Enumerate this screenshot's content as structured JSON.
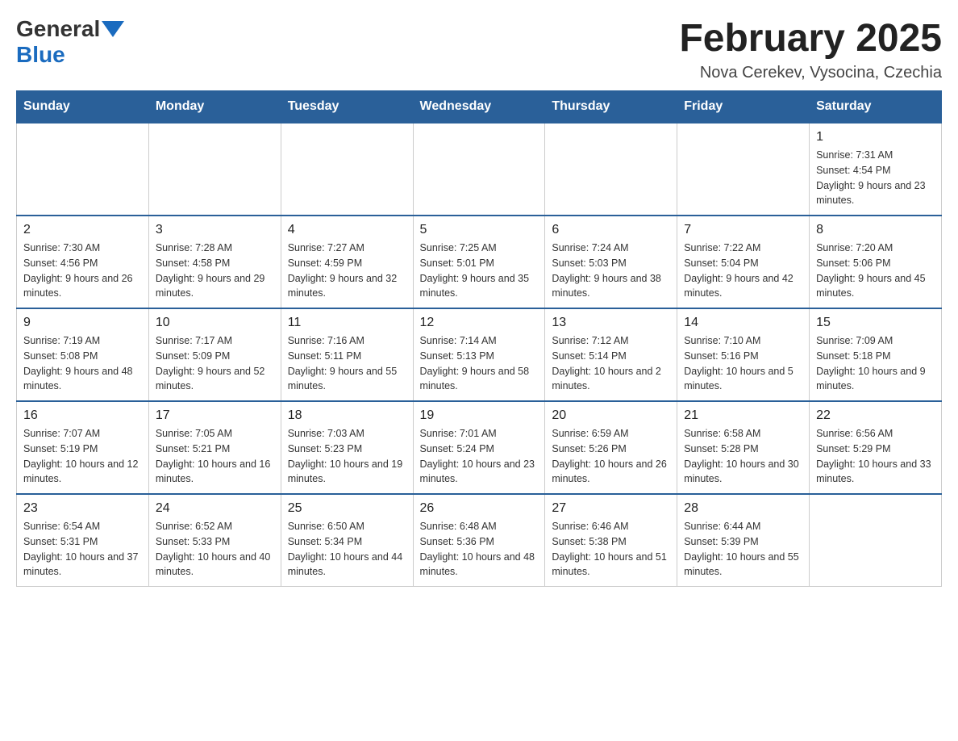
{
  "header": {
    "logo_general": "General",
    "logo_blue": "Blue",
    "month_title": "February 2025",
    "location": "Nova Cerekev, Vysocina, Czechia"
  },
  "weekdays": [
    "Sunday",
    "Monday",
    "Tuesday",
    "Wednesday",
    "Thursday",
    "Friday",
    "Saturday"
  ],
  "weeks": [
    [
      {
        "day": "",
        "sunrise": "",
        "sunset": "",
        "daylight": ""
      },
      {
        "day": "",
        "sunrise": "",
        "sunset": "",
        "daylight": ""
      },
      {
        "day": "",
        "sunrise": "",
        "sunset": "",
        "daylight": ""
      },
      {
        "day": "",
        "sunrise": "",
        "sunset": "",
        "daylight": ""
      },
      {
        "day": "",
        "sunrise": "",
        "sunset": "",
        "daylight": ""
      },
      {
        "day": "",
        "sunrise": "",
        "sunset": "",
        "daylight": ""
      },
      {
        "day": "1",
        "sunrise": "Sunrise: 7:31 AM",
        "sunset": "Sunset: 4:54 PM",
        "daylight": "Daylight: 9 hours and 23 minutes."
      }
    ],
    [
      {
        "day": "2",
        "sunrise": "Sunrise: 7:30 AM",
        "sunset": "Sunset: 4:56 PM",
        "daylight": "Daylight: 9 hours and 26 minutes."
      },
      {
        "day": "3",
        "sunrise": "Sunrise: 7:28 AM",
        "sunset": "Sunset: 4:58 PM",
        "daylight": "Daylight: 9 hours and 29 minutes."
      },
      {
        "day": "4",
        "sunrise": "Sunrise: 7:27 AM",
        "sunset": "Sunset: 4:59 PM",
        "daylight": "Daylight: 9 hours and 32 minutes."
      },
      {
        "day": "5",
        "sunrise": "Sunrise: 7:25 AM",
        "sunset": "Sunset: 5:01 PM",
        "daylight": "Daylight: 9 hours and 35 minutes."
      },
      {
        "day": "6",
        "sunrise": "Sunrise: 7:24 AM",
        "sunset": "Sunset: 5:03 PM",
        "daylight": "Daylight: 9 hours and 38 minutes."
      },
      {
        "day": "7",
        "sunrise": "Sunrise: 7:22 AM",
        "sunset": "Sunset: 5:04 PM",
        "daylight": "Daylight: 9 hours and 42 minutes."
      },
      {
        "day": "8",
        "sunrise": "Sunrise: 7:20 AM",
        "sunset": "Sunset: 5:06 PM",
        "daylight": "Daylight: 9 hours and 45 minutes."
      }
    ],
    [
      {
        "day": "9",
        "sunrise": "Sunrise: 7:19 AM",
        "sunset": "Sunset: 5:08 PM",
        "daylight": "Daylight: 9 hours and 48 minutes."
      },
      {
        "day": "10",
        "sunrise": "Sunrise: 7:17 AM",
        "sunset": "Sunset: 5:09 PM",
        "daylight": "Daylight: 9 hours and 52 minutes."
      },
      {
        "day": "11",
        "sunrise": "Sunrise: 7:16 AM",
        "sunset": "Sunset: 5:11 PM",
        "daylight": "Daylight: 9 hours and 55 minutes."
      },
      {
        "day": "12",
        "sunrise": "Sunrise: 7:14 AM",
        "sunset": "Sunset: 5:13 PM",
        "daylight": "Daylight: 9 hours and 58 minutes."
      },
      {
        "day": "13",
        "sunrise": "Sunrise: 7:12 AM",
        "sunset": "Sunset: 5:14 PM",
        "daylight": "Daylight: 10 hours and 2 minutes."
      },
      {
        "day": "14",
        "sunrise": "Sunrise: 7:10 AM",
        "sunset": "Sunset: 5:16 PM",
        "daylight": "Daylight: 10 hours and 5 minutes."
      },
      {
        "day": "15",
        "sunrise": "Sunrise: 7:09 AM",
        "sunset": "Sunset: 5:18 PM",
        "daylight": "Daylight: 10 hours and 9 minutes."
      }
    ],
    [
      {
        "day": "16",
        "sunrise": "Sunrise: 7:07 AM",
        "sunset": "Sunset: 5:19 PM",
        "daylight": "Daylight: 10 hours and 12 minutes."
      },
      {
        "day": "17",
        "sunrise": "Sunrise: 7:05 AM",
        "sunset": "Sunset: 5:21 PM",
        "daylight": "Daylight: 10 hours and 16 minutes."
      },
      {
        "day": "18",
        "sunrise": "Sunrise: 7:03 AM",
        "sunset": "Sunset: 5:23 PM",
        "daylight": "Daylight: 10 hours and 19 minutes."
      },
      {
        "day": "19",
        "sunrise": "Sunrise: 7:01 AM",
        "sunset": "Sunset: 5:24 PM",
        "daylight": "Daylight: 10 hours and 23 minutes."
      },
      {
        "day": "20",
        "sunrise": "Sunrise: 6:59 AM",
        "sunset": "Sunset: 5:26 PM",
        "daylight": "Daylight: 10 hours and 26 minutes."
      },
      {
        "day": "21",
        "sunrise": "Sunrise: 6:58 AM",
        "sunset": "Sunset: 5:28 PM",
        "daylight": "Daylight: 10 hours and 30 minutes."
      },
      {
        "day": "22",
        "sunrise": "Sunrise: 6:56 AM",
        "sunset": "Sunset: 5:29 PM",
        "daylight": "Daylight: 10 hours and 33 minutes."
      }
    ],
    [
      {
        "day": "23",
        "sunrise": "Sunrise: 6:54 AM",
        "sunset": "Sunset: 5:31 PM",
        "daylight": "Daylight: 10 hours and 37 minutes."
      },
      {
        "day": "24",
        "sunrise": "Sunrise: 6:52 AM",
        "sunset": "Sunset: 5:33 PM",
        "daylight": "Daylight: 10 hours and 40 minutes."
      },
      {
        "day": "25",
        "sunrise": "Sunrise: 6:50 AM",
        "sunset": "Sunset: 5:34 PM",
        "daylight": "Daylight: 10 hours and 44 minutes."
      },
      {
        "day": "26",
        "sunrise": "Sunrise: 6:48 AM",
        "sunset": "Sunset: 5:36 PM",
        "daylight": "Daylight: 10 hours and 48 minutes."
      },
      {
        "day": "27",
        "sunrise": "Sunrise: 6:46 AM",
        "sunset": "Sunset: 5:38 PM",
        "daylight": "Daylight: 10 hours and 51 minutes."
      },
      {
        "day": "28",
        "sunrise": "Sunrise: 6:44 AM",
        "sunset": "Sunset: 5:39 PM",
        "daylight": "Daylight: 10 hours and 55 minutes."
      },
      {
        "day": "",
        "sunrise": "",
        "sunset": "",
        "daylight": ""
      }
    ]
  ]
}
